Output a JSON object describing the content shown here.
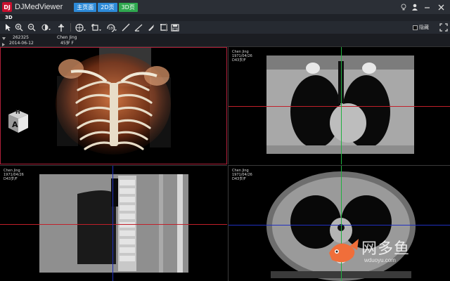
{
  "app": {
    "logo_text": "DJ",
    "title": "DJMedViewer",
    "tabs": [
      "主页面",
      "2D页",
      "3D页"
    ]
  },
  "mode_label": "3D",
  "toolbar": {
    "hide_checkbox_label": "隐藏"
  },
  "patient": {
    "id": "262325",
    "name": "Chen Jing",
    "date": "2014-06-12",
    "age_sex": "45岁 F"
  },
  "viewports": {
    "coronal": {
      "line1": "Chen Jing",
      "line2": "1971/04/26",
      "line3": "D43岁/F"
    },
    "sagittal": {
      "line1": "Chen Jing",
      "line2": "1971/04/26",
      "line3": "D43岁/F"
    },
    "axial": {
      "line1": "Chen Jing",
      "line2": "1971/04/26",
      "line3": "D43岁/F"
    }
  },
  "orientation_cube": {
    "top": "H",
    "front": "A"
  },
  "watermark": {
    "text": "网多鱼",
    "url": "wduoyu.com"
  },
  "colors": {
    "accent_blue": "#2d8ad8",
    "accent_green": "#2fa84f",
    "active_border": "#b0203a",
    "crosshair_red": "#c0202a",
    "crosshair_green": "#20b040",
    "crosshair_blue": "#2030c0"
  }
}
